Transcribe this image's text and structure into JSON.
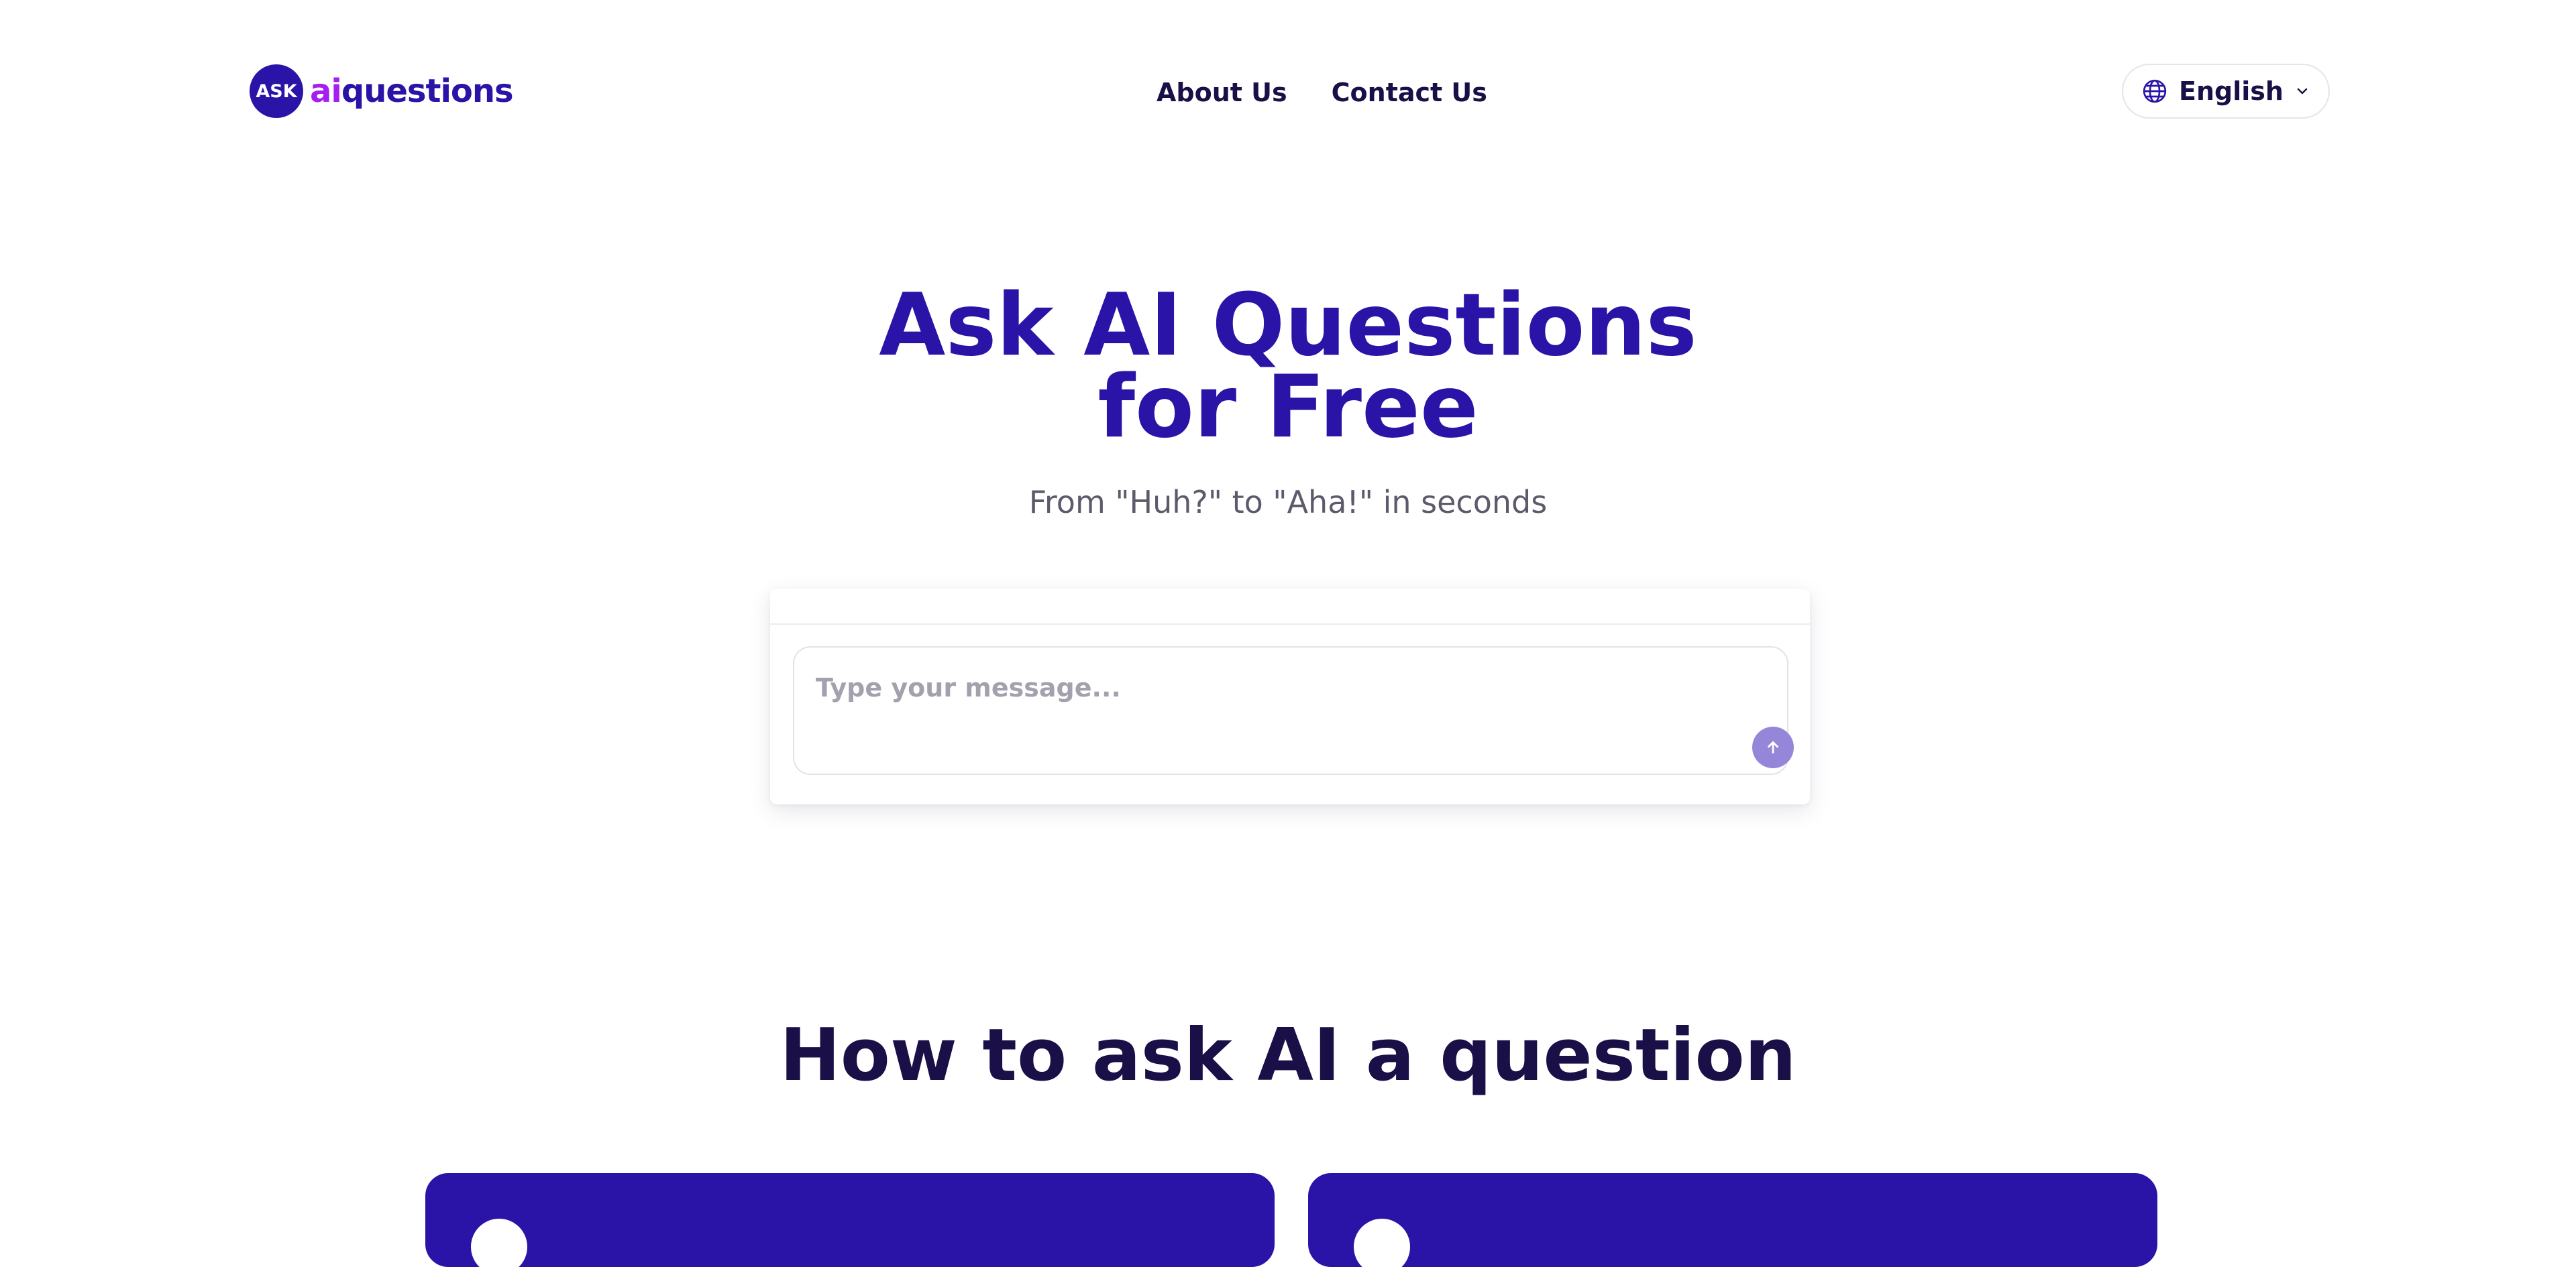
{
  "brand": {
    "badge": "ASK",
    "name_accent": "ai",
    "name_rest": "questions",
    "primary_color": "#2a14a8",
    "accent_color": "#a41ff0"
  },
  "nav": {
    "items": [
      {
        "label": "About Us"
      },
      {
        "label": "Contact Us"
      }
    ]
  },
  "language": {
    "icon": "globe-icon",
    "selected": "English",
    "chevron": "chevron-down-icon"
  },
  "hero": {
    "title_line1": "Ask AI Questions",
    "title_line2": "for Free",
    "subtitle": "From \"Huh?\" to \"Aha!\" in seconds"
  },
  "chat": {
    "value": "",
    "placeholder": "Type your message...",
    "send_icon": "arrow-up-icon",
    "send_color": "#9586d9"
  },
  "how_to": {
    "title": "How to ask AI a question"
  }
}
